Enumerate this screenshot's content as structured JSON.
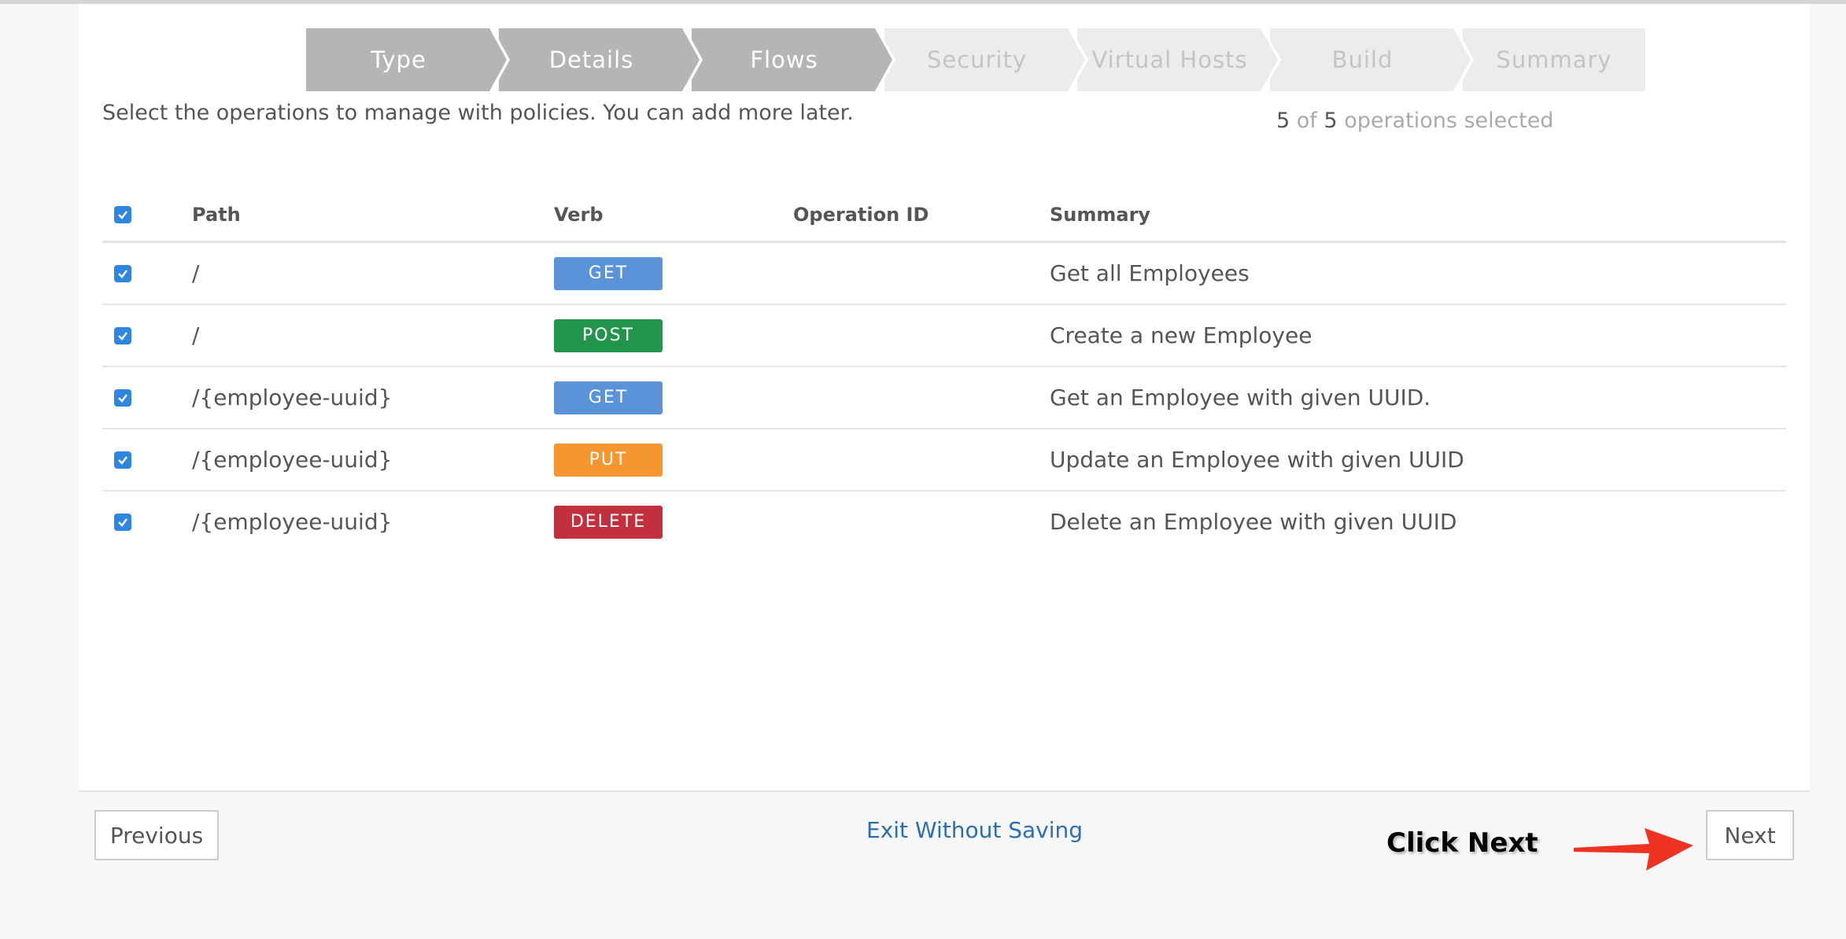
{
  "wizard": {
    "steps": [
      {
        "label": "Type",
        "state": "done"
      },
      {
        "label": "Details",
        "state": "done"
      },
      {
        "label": "Flows",
        "state": "done"
      },
      {
        "label": "Security",
        "state": "todo"
      },
      {
        "label": "Virtual Hosts",
        "state": "todo"
      },
      {
        "label": "Build",
        "state": "todo"
      },
      {
        "label": "Summary",
        "state": "todo"
      }
    ]
  },
  "intro_text": "Select the operations to manage with policies. You can add more later.",
  "selection": {
    "selected": "5",
    "of_label": "of",
    "total": "5",
    "suffix": "operations selected"
  },
  "table": {
    "headers": {
      "path": "Path",
      "verb": "Verb",
      "operation_id": "Operation ID",
      "summary": "Summary"
    },
    "rows": [
      {
        "path": "/",
        "verb": "GET",
        "operation_id": "",
        "summary": "Get all Employees",
        "checked": true
      },
      {
        "path": "/",
        "verb": "POST",
        "operation_id": "",
        "summary": "Create a new Employee",
        "checked": true
      },
      {
        "path": "/{employee-uuid}",
        "verb": "GET",
        "operation_id": "",
        "summary": "Get an Employee with given UUID.",
        "checked": true
      },
      {
        "path": "/{employee-uuid}",
        "verb": "PUT",
        "operation_id": "",
        "summary": "Update an Employee with given UUID",
        "checked": true
      },
      {
        "path": "/{employee-uuid}",
        "verb": "DELETE",
        "operation_id": "",
        "summary": "Delete an Employee with given UUID",
        "checked": true
      }
    ]
  },
  "verb_colors": {
    "GET": "#5b93d8",
    "POST": "#21964a",
    "PUT": "#f5962f",
    "DELETE": "#c2303d"
  },
  "footer": {
    "previous_label": "Previous",
    "exit_label": "Exit Without Saving",
    "next_label": "Next"
  },
  "annotation": {
    "text": "Click Next",
    "arrow_color": "#ee3322"
  },
  "colors": {
    "checkbox": "#2f86e0",
    "link": "#2a6fb0",
    "step_done": "#b5b5b5",
    "step_todo": "#ececec"
  }
}
